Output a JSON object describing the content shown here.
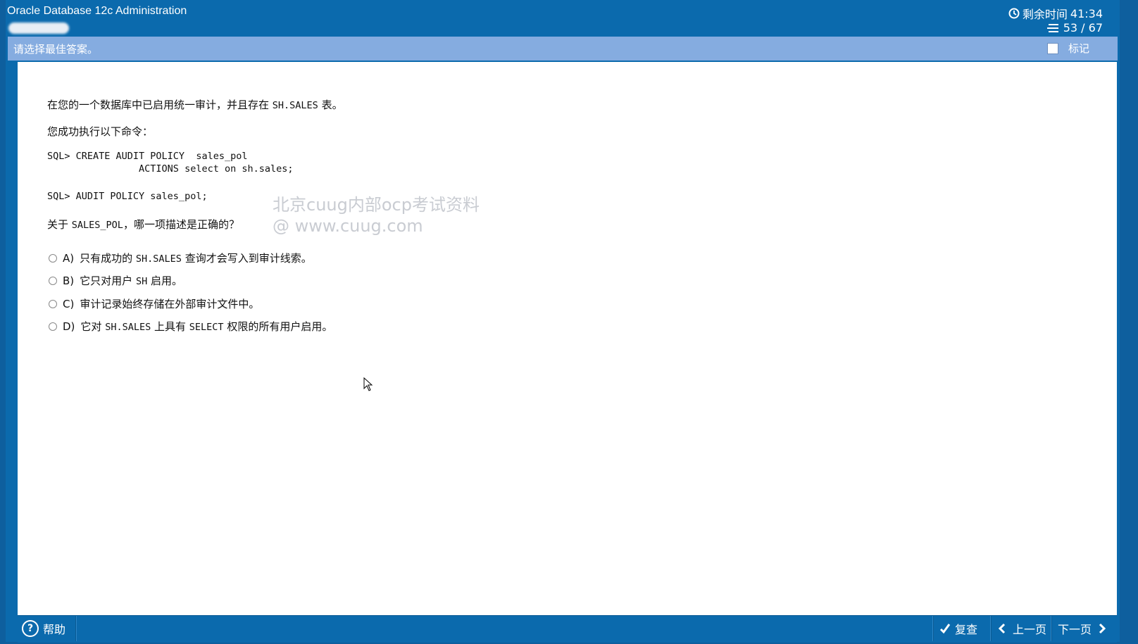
{
  "header": {
    "app_title": "Oracle Database 12c Administration",
    "timer_label": "剩余时间",
    "timer_value": "41:34",
    "progress": "53 / 67"
  },
  "instruction": {
    "text": "请选择最佳答案。",
    "mark_label": "标记"
  },
  "question": {
    "intro_prefix": "在您的一个数据库中已启用统一审计，并且存在 ",
    "intro_code": "SH.SALES",
    "intro_suffix": " 表。",
    "exec_text": "您成功执行以下命令：",
    "sql1": "SQL> CREATE AUDIT POLICY  sales_pol\n                ACTIONS select on sh.sales;",
    "sql2": "SQL> AUDIT POLICY sales_pol;",
    "prompt_prefix": "关于 ",
    "prompt_code": "SALES_POL",
    "prompt_suffix": "，哪一项描述是正确的？"
  },
  "options": {
    "a": {
      "letter": "A)",
      "t1": "只有成功的 ",
      "c1": "SH.SALES",
      "t2": " 查询才会写入到审计线索。"
    },
    "b": {
      "letter": "B)",
      "t1": "它只对用户 ",
      "c1": "SH",
      "t2": " 启用。"
    },
    "c": {
      "letter": "C)",
      "t1": "审计记录始终存储在外部审计文件中。"
    },
    "d": {
      "letter": "D)",
      "t1": "它对 ",
      "c1": "SH.SALES",
      "t2": " 上具有 ",
      "c2": "SELECT",
      "t3": " 权限的所有用户启用。"
    }
  },
  "watermark": {
    "line1": "北京cuug内部ocp考试资料",
    "line2": "@ www.cuug.com"
  },
  "footer": {
    "help_label": "帮助",
    "review_label": "复查",
    "prev_label": "上一页",
    "next_label": "下一页"
  },
  "colors": {
    "titlebar": "#0b6aad",
    "instruction_bar": "#85ace0",
    "content_bg": "#ffffff"
  }
}
